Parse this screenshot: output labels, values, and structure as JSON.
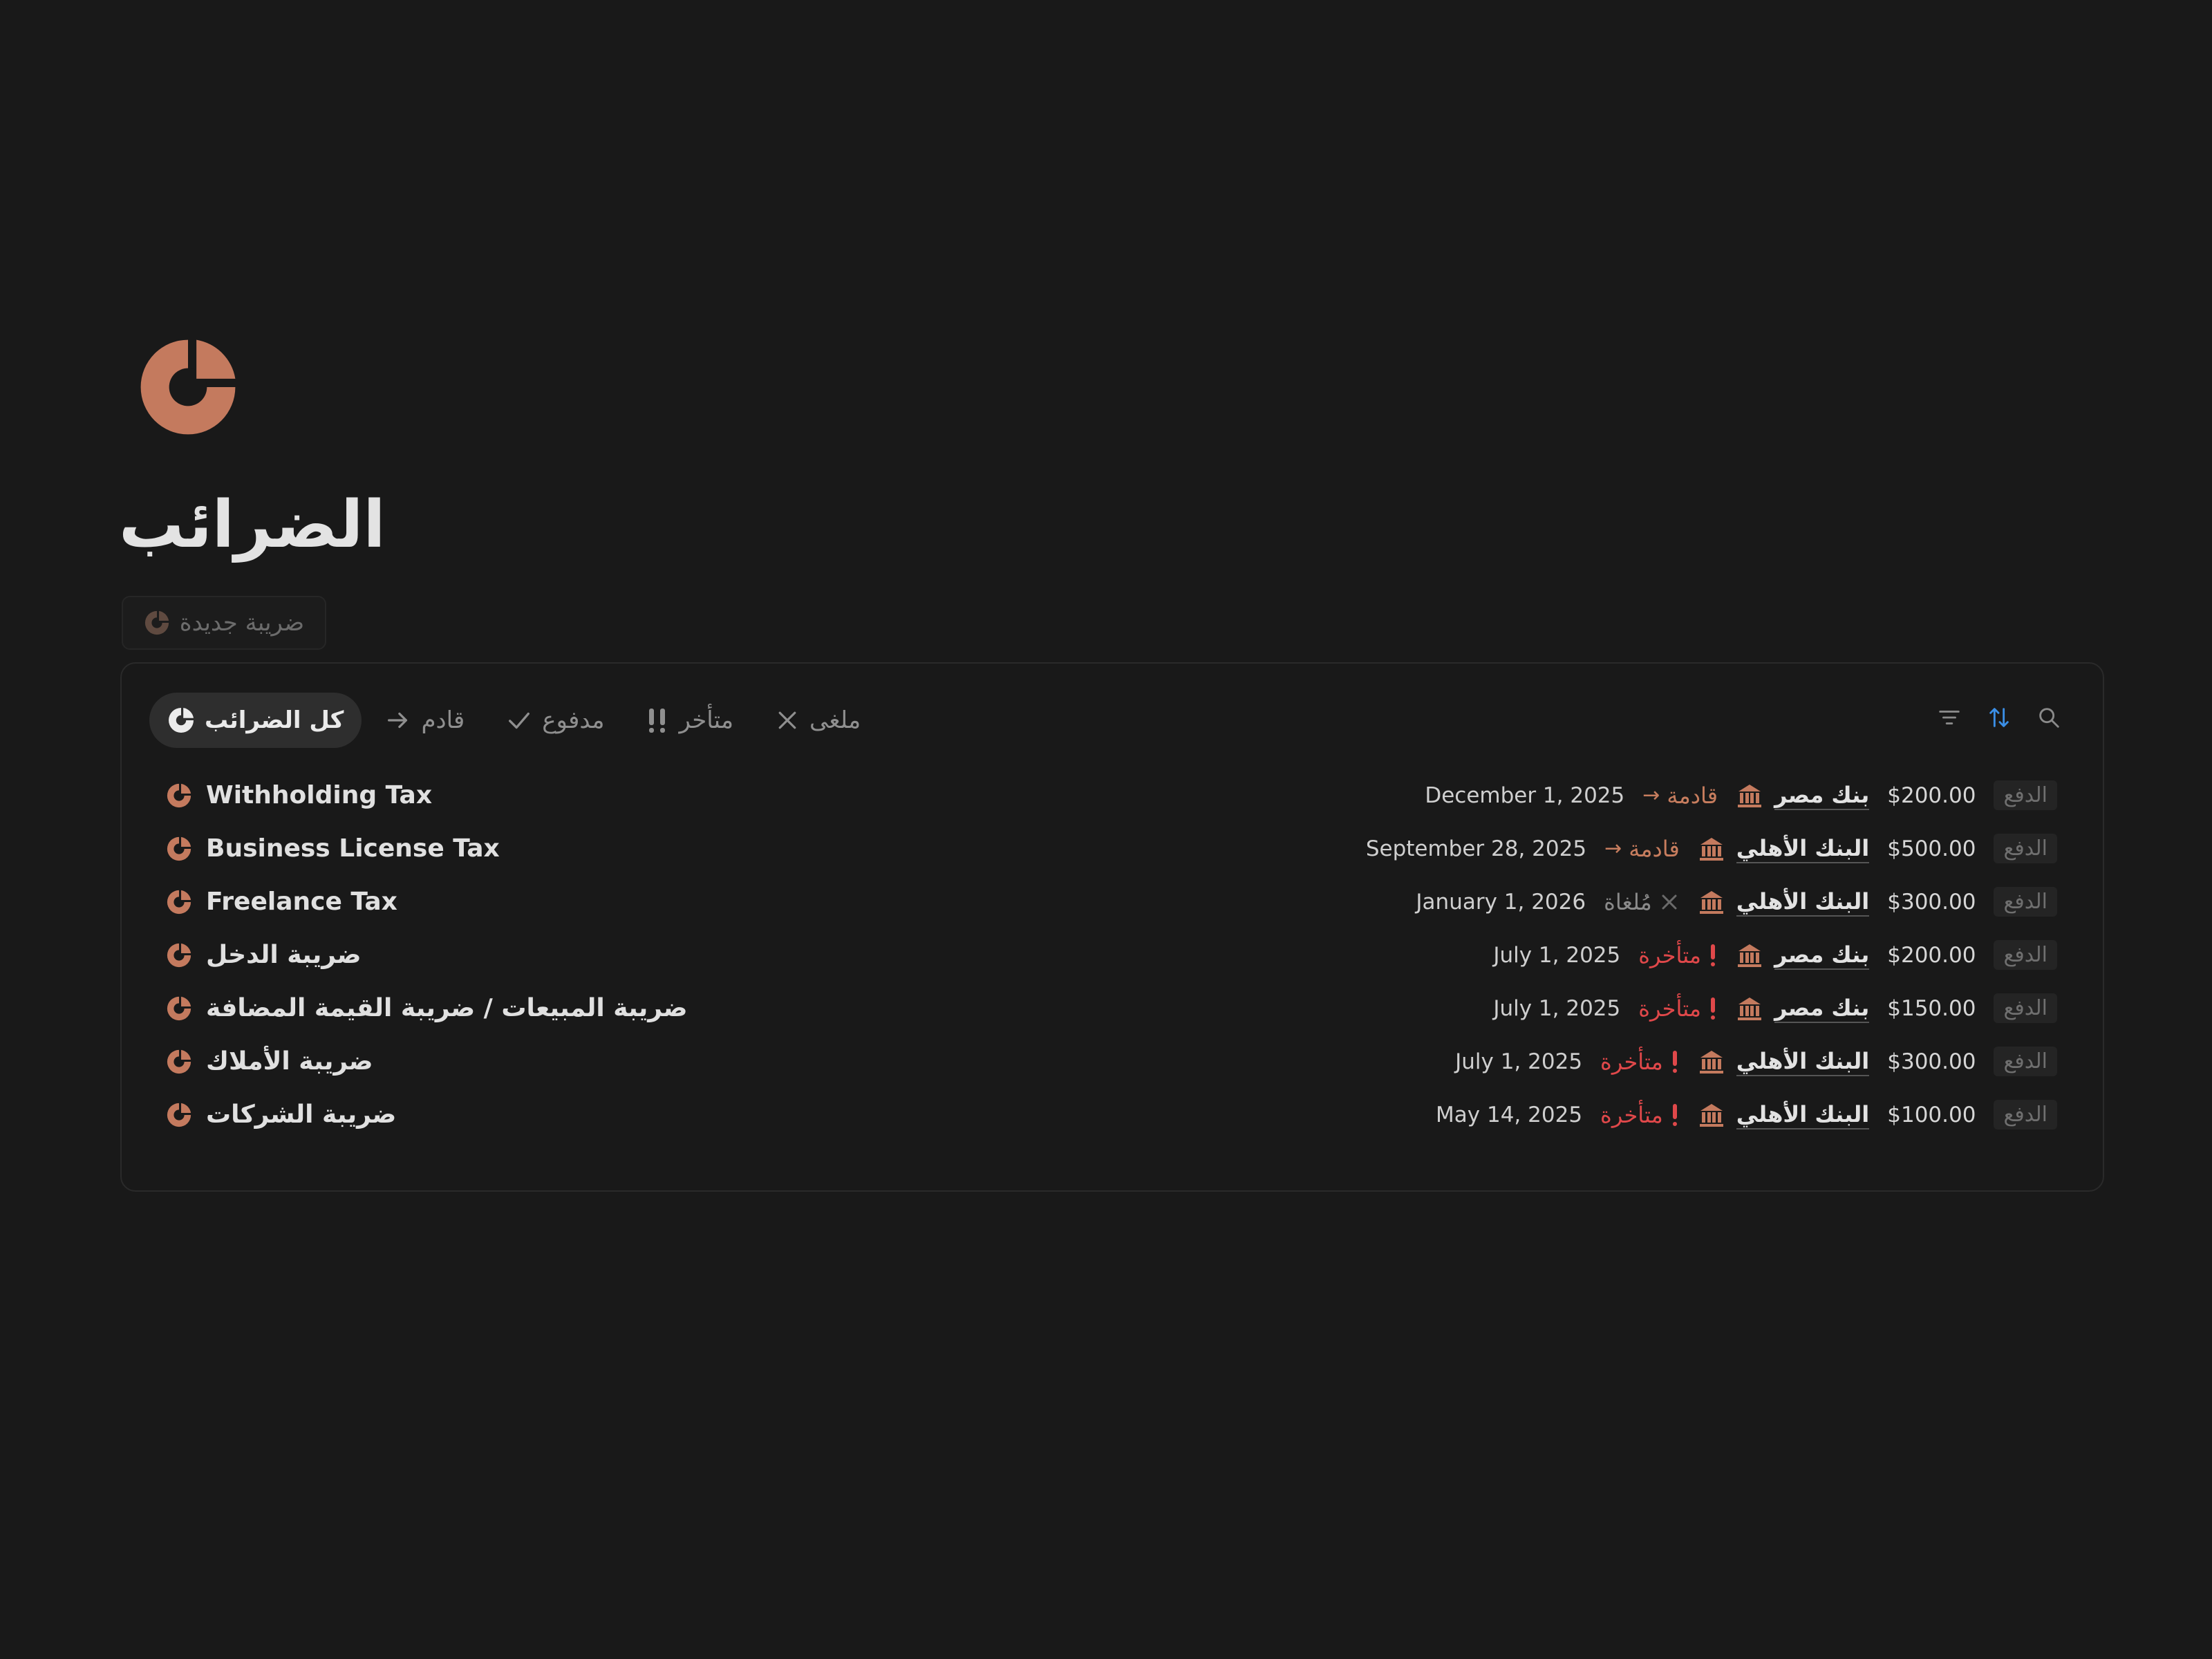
{
  "page": {
    "title": "الضرائب",
    "new_button_label": "ضريبة جديدة"
  },
  "colors": {
    "accent": "#c47a5e",
    "late": "#e0484a",
    "background": "#191919"
  },
  "tabs": [
    {
      "label": "كل الضرائب",
      "icon": "tax-icon",
      "active": true
    },
    {
      "label": "قادم",
      "icon": "arrow-right-icon"
    },
    {
      "label": "مدفوع",
      "icon": "check-icon"
    },
    {
      "label": "متأخر",
      "icon": "double-exclamation-icon"
    },
    {
      "label": "ملغى",
      "icon": "x-icon"
    }
  ],
  "toolbar": {
    "icons": [
      "filter-icon",
      "sort-icon",
      "search-icon"
    ]
  },
  "rows": [
    {
      "title": "Withholding Tax",
      "date": "December 1, 2025",
      "status": "قادمة",
      "status_type": "upcoming",
      "bank": "بنك مصر",
      "amount": "$200.00",
      "pay": "الدفع"
    },
    {
      "title": "Business License Tax",
      "date": "September 28, 2025",
      "status": "قادمة",
      "status_type": "upcoming",
      "bank": "البنك الأهلي",
      "amount": "$500.00",
      "pay": "الدفع"
    },
    {
      "title": "Freelance Tax",
      "date": "January 1, 2026",
      "status": "مُلغاة",
      "status_type": "cancelled",
      "bank": "البنك الأهلي",
      "amount": "$300.00",
      "pay": "الدفع"
    },
    {
      "title": "ضريبة الدخل",
      "date": "July 1, 2025",
      "status": "متأخرة",
      "status_type": "late",
      "bank": "بنك مصر",
      "amount": "$200.00",
      "pay": "الدفع"
    },
    {
      "title": "ضريبة المبيعات / ضريبة القيمة المضافة",
      "date": "July 1, 2025",
      "status": "متأخرة",
      "status_type": "late",
      "bank": "بنك مصر",
      "amount": "$150.00",
      "pay": "الدفع"
    },
    {
      "title": "ضريبة الأملاك",
      "date": "July 1, 2025",
      "status": "متأخرة",
      "status_type": "late",
      "bank": "البنك الأهلي",
      "amount": "$300.00",
      "pay": "الدفع"
    },
    {
      "title": "ضريبة الشركات",
      "date": "May 14, 2025",
      "status": "متأخرة",
      "status_type": "late",
      "bank": "البنك الأهلي",
      "amount": "$100.00",
      "pay": "الدفع"
    }
  ]
}
